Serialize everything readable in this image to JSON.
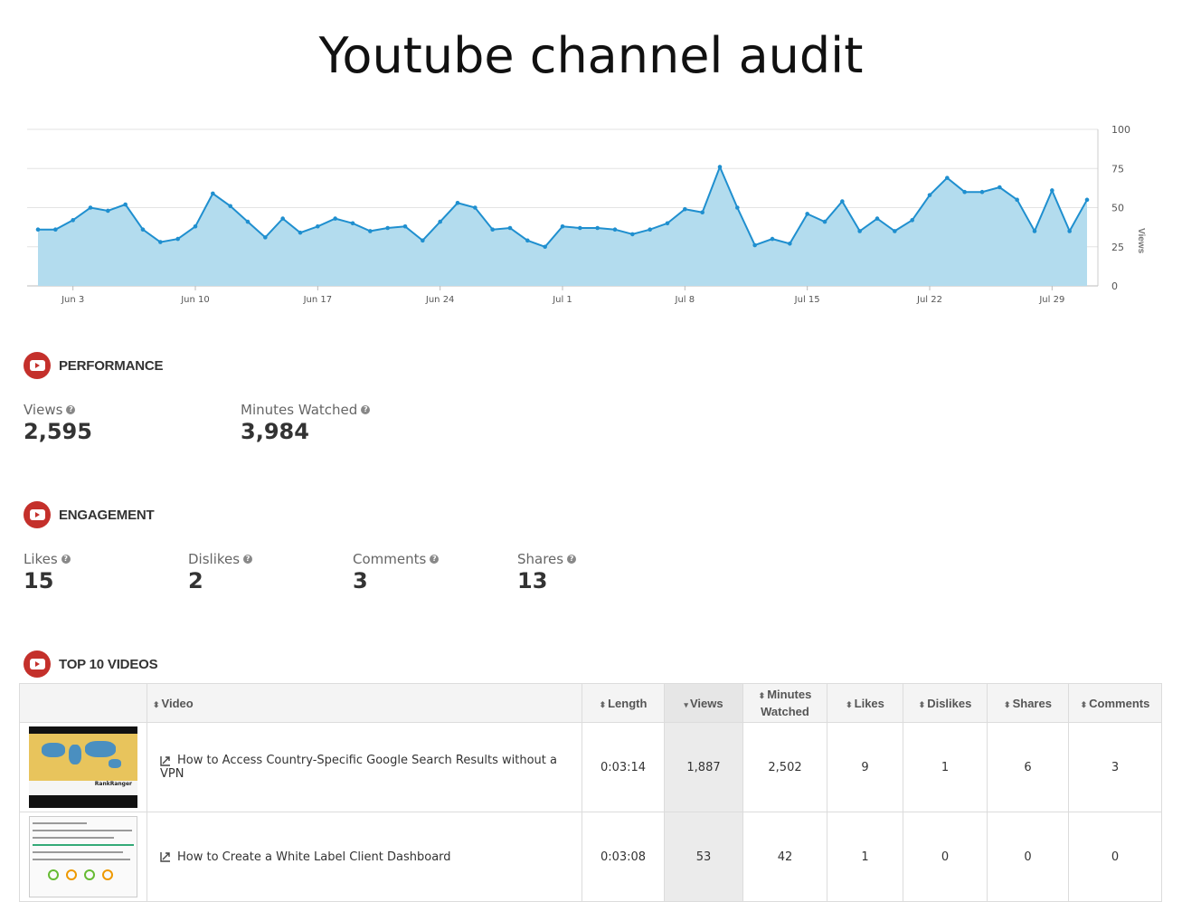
{
  "page": {
    "title": "Youtube channel audit"
  },
  "chart_data": {
    "type": "area",
    "ylabel": "Views",
    "ylim": [
      0,
      100
    ],
    "yticks": [
      "0",
      "25",
      "50",
      "75",
      "100"
    ],
    "x_tick_labels": [
      "Jun 3",
      "Jun 10",
      "Jun 17",
      "Jun 24",
      "Jul 1",
      "Jul 8",
      "Jul 15",
      "Jul 22",
      "Jul 29"
    ],
    "x": [
      "Jun 1",
      "Jun 2",
      "Jun 3",
      "Jun 4",
      "Jun 5",
      "Jun 6",
      "Jun 7",
      "Jun 8",
      "Jun 9",
      "Jun 10",
      "Jun 11",
      "Jun 12",
      "Jun 13",
      "Jun 14",
      "Jun 15",
      "Jun 16",
      "Jun 17",
      "Jun 18",
      "Jun 19",
      "Jun 20",
      "Jun 21",
      "Jun 22",
      "Jun 23",
      "Jun 24",
      "Jun 25",
      "Jun 26",
      "Jun 27",
      "Jun 28",
      "Jun 29",
      "Jun 30",
      "Jul 1",
      "Jul 2",
      "Jul 3",
      "Jul 4",
      "Jul 5",
      "Jul 6",
      "Jul 7",
      "Jul 8",
      "Jul 9",
      "Jul 10",
      "Jul 11",
      "Jul 12",
      "Jul 13",
      "Jul 14",
      "Jul 15",
      "Jul 16",
      "Jul 17",
      "Jul 18",
      "Jul 19",
      "Jul 20",
      "Jul 21",
      "Jul 22",
      "Jul 23",
      "Jul 24",
      "Jul 25",
      "Jul 26",
      "Jul 27",
      "Jul 28",
      "Jul 29",
      "Jul 30",
      "Jul 31"
    ],
    "values": [
      36,
      36,
      42,
      50,
      48,
      52,
      36,
      28,
      30,
      38,
      59,
      51,
      41,
      31,
      43,
      34,
      38,
      43,
      40,
      35,
      37,
      38,
      29,
      41,
      53,
      50,
      36,
      37,
      29,
      25,
      38,
      37,
      37,
      36,
      33,
      36,
      40,
      49,
      47,
      76,
      50,
      26,
      30,
      27,
      46,
      41,
      54,
      35,
      43,
      35,
      42,
      58,
      69,
      60,
      60,
      63,
      55,
      35,
      61,
      35,
      55
    ],
    "grid": true,
    "colors": {
      "line": "#1f8fcf",
      "fill": "#b3dcee"
    }
  },
  "performance": {
    "label": "PERFORMANCE",
    "views_label": "Views",
    "views_value": "2,595",
    "minutes_label": "Minutes Watched",
    "minutes_value": "3,984"
  },
  "engagement": {
    "label": "ENGAGEMENT",
    "likes_label": "Likes",
    "likes_value": "15",
    "dislikes_label": "Dislikes",
    "dislikes_value": "2",
    "comments_label": "Comments",
    "comments_value": "3",
    "shares_label": "Shares",
    "shares_value": "13"
  },
  "top_videos": {
    "label": "TOP 10 VIDEOS",
    "columns": {
      "video": "Video",
      "length": "Length",
      "views": "Views",
      "minutes_line1": "Minutes",
      "minutes_line2": "Watched",
      "likes": "Likes",
      "dislikes": "Dislikes",
      "shares": "Shares",
      "comments": "Comments"
    },
    "rows": [
      {
        "title": "How to Access Country-Specific Google Search Results without a VPN",
        "length": "0:03:14",
        "views": "1,887",
        "minutes": "2,502",
        "likes": "9",
        "dislikes": "1",
        "shares": "6",
        "comments": "3",
        "thumb_text": "RankRanger"
      },
      {
        "title": "How to Create a White Label Client Dashboard",
        "length": "0:03:08",
        "views": "53",
        "minutes": "42",
        "likes": "1",
        "dislikes": "0",
        "shares": "0",
        "comments": "0"
      }
    ]
  },
  "icons": {
    "section": "youtube-icon",
    "help": "question-icon",
    "external": "external-link-icon",
    "sort": "sort-icon"
  }
}
